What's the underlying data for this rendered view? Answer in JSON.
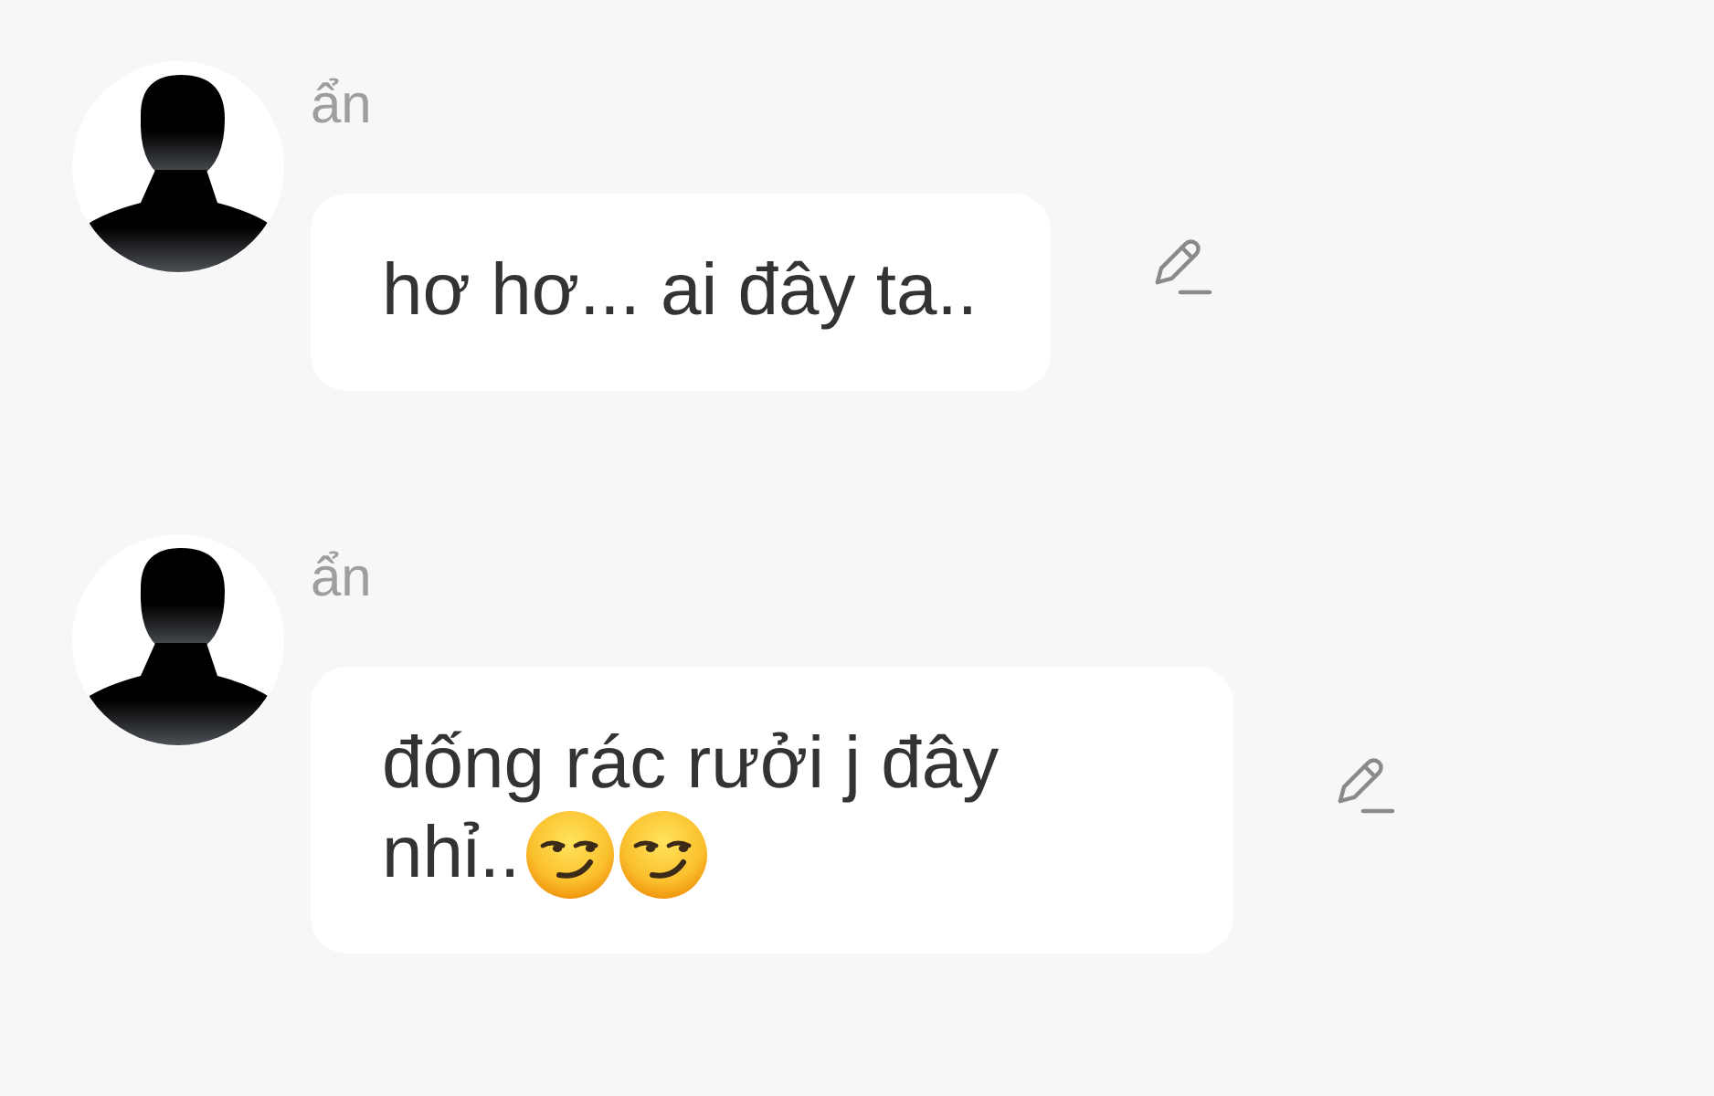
{
  "messages": [
    {
      "sender": "ẩn",
      "lines": [
        "hơ hơ... ai đây ta.."
      ]
    },
    {
      "sender": "ẩn",
      "lines": [
        "đống rác rưởi j đây",
        "nhỉ.."
      ],
      "emojis": [
        {
          "kind": "smirk"
        },
        {
          "kind": "smirk"
        }
      ]
    }
  ]
}
